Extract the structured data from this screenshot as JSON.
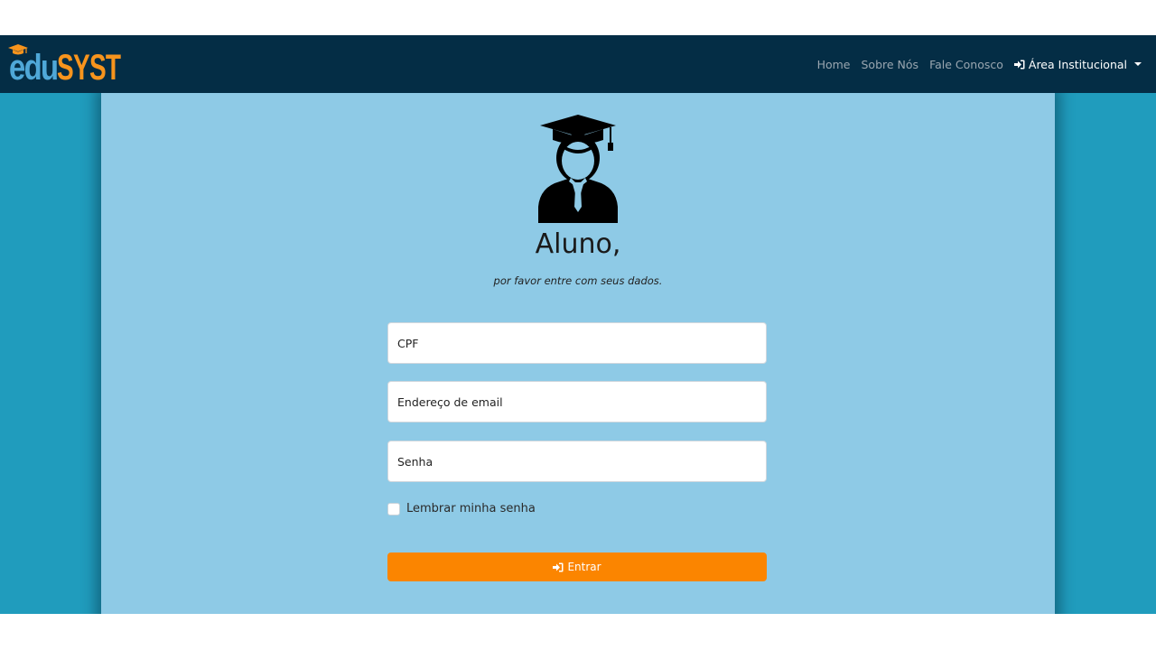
{
  "brand": {
    "part1": "edu",
    "part2": "SYST",
    "icon": "graduation-cap-icon",
    "colors": {
      "primary": "#4fa8d8",
      "accent": "#f7941d"
    }
  },
  "nav": {
    "items": [
      {
        "label": "Home"
      },
      {
        "label": "Sobre Nós"
      },
      {
        "label": "Fale Conosco"
      }
    ],
    "dropdown": {
      "label": "Área Institucional",
      "icon": "sign-in-icon"
    }
  },
  "login": {
    "avatar_icon": "graduate-student-icon",
    "title": "Aluno,",
    "subtitle": "por favor entre com seus dados.",
    "cpf_placeholder": "CPF",
    "email_placeholder": "Endereço de email",
    "password_placeholder": "Senha",
    "remember_label": "Lembrar minha senha",
    "submit_label": "Entrar",
    "submit_icon": "sign-in-icon"
  },
  "colors": {
    "navbar": "#042d45",
    "background": "#209cbd",
    "panel": "#8ecae6",
    "button": "#fb8500"
  }
}
